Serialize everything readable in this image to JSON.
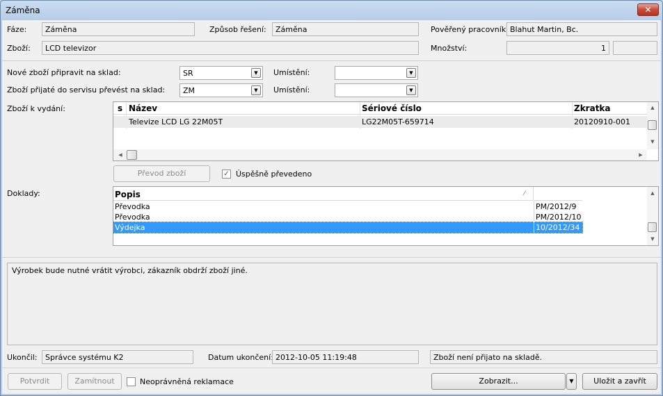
{
  "window": {
    "title": "Záměna",
    "close_glyph": "✕"
  },
  "header": {
    "phase_label": "Fáze:",
    "phase_value": "Záměna",
    "method_label": "Způsob řešení:",
    "method_value": "Záměna",
    "worker_label": "Pověřený pracovník:",
    "worker_value": "Blahut Martin, Bc.",
    "goods_label": "Zboží:",
    "goods_value": "LCD televizor",
    "qty_label": "Množství:",
    "qty_value": "1",
    "qty_unit": ""
  },
  "stock": {
    "new_goods_label": "Nové zboží připravit na sklad:",
    "new_goods_value": "SR",
    "location1_label": "Umístění:",
    "location1_value": "",
    "received_goods_label": "Zboží přijaté do servisu převést na sklad:",
    "received_goods_value": "ZM",
    "location2_label": "Umístění:",
    "location2_value": ""
  },
  "issue_grid": {
    "label": "Zboží k vydání:",
    "columns": [
      "s",
      "Název",
      "Sériové číslo",
      "Zkratka"
    ],
    "rows": [
      {
        "s": "",
        "name": "Televize LCD LG 22M05T",
        "serial": "LG22M05T-659714",
        "code": "20120910-001"
      }
    ]
  },
  "transfer": {
    "button_label": "Převod zboží",
    "success_label": "Úspěšně převedeno",
    "success_checked": true
  },
  "docs_grid": {
    "label": "Doklady:",
    "columns": [
      "Popis",
      ""
    ],
    "rows": [
      {
        "desc": "Převodka",
        "num": "PM/2012/9",
        "selected": false
      },
      {
        "desc": "Převodka",
        "num": "PM/2012/10",
        "selected": false
      },
      {
        "desc": "Výdejka",
        "num": "10/2012/34",
        "selected": true
      }
    ]
  },
  "note_text": "Výrobek bude nutné vrátit výrobci, zákazník obdrží zboží jiné.",
  "footer": {
    "closed_by_label": "Ukončil:",
    "closed_by_value": "Správce systému K2",
    "closed_date_label": "Datum ukončení:",
    "closed_date_value": "2012-10-05 11:19:48",
    "status_value": "Zboží není přijato na skladě."
  },
  "actions": {
    "confirm_label": "Potvrdit",
    "reject_label": "Zamítnout",
    "unjustified_label": "Neoprávněná reklamace",
    "show_label": "Zobrazit...",
    "save_close_label": "Uložit a zavřít"
  }
}
